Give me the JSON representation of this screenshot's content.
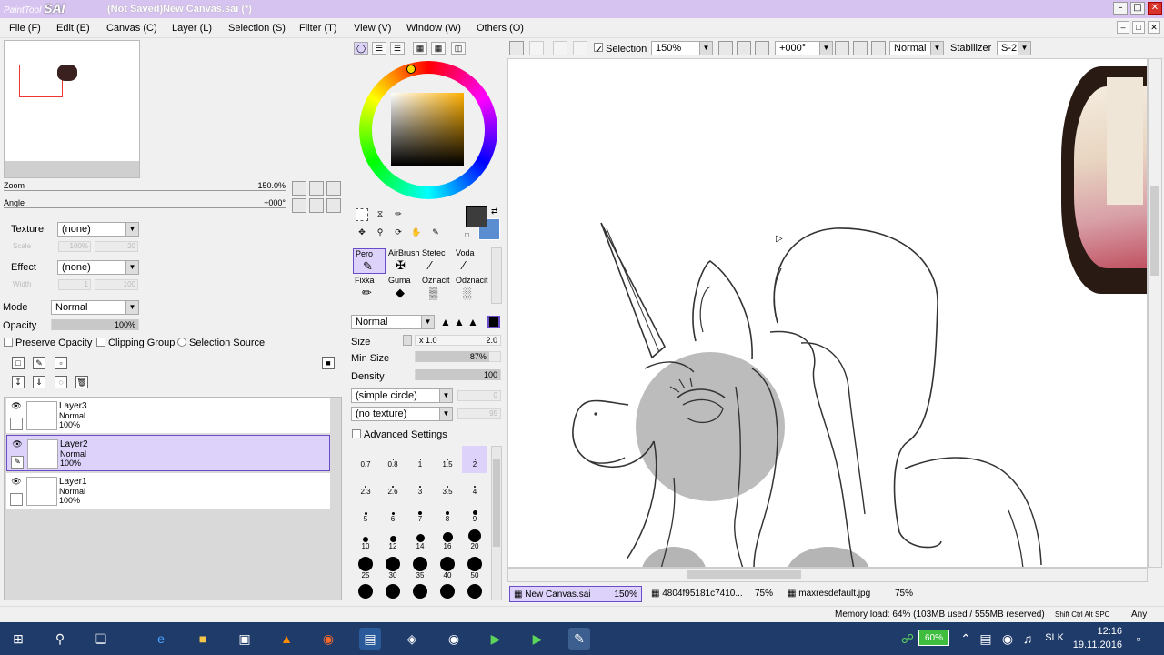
{
  "app": {
    "logo_small": "PaintTool",
    "logo_big": "SAI",
    "title": "(Not Saved)New Canvas.sai (*)"
  },
  "menu": {
    "file": "File (F)",
    "edit": "Edit (E)",
    "canvas": "Canvas (C)",
    "layer": "Layer (L)",
    "selection": "Selection (S)",
    "filter": "Filter (T)",
    "view": "View (V)",
    "window": "Window (W)",
    "others": "Others (O)"
  },
  "navigator": {
    "zoom_label": "Zoom",
    "zoom_value": "150.0%",
    "angle_label": "Angle",
    "angle_value": "+000°"
  },
  "layer_props": {
    "texture_label": "Texture",
    "texture_value": "(none)",
    "scale_label": "Scale",
    "scale_value": "100%",
    "scale_right": "20",
    "effect_label": "Effect",
    "effect_value": "(none)",
    "width_label": "Width",
    "width_value": "1",
    "width_right": "100",
    "mode_label": "Mode",
    "mode_value": "Normal",
    "opacity_label": "Opacity",
    "opacity_value": "100%",
    "preserve_opacity": "Preserve Opacity",
    "clipping_group": "Clipping Group",
    "selection_source": "Selection Source"
  },
  "layers": [
    {
      "name": "Layer3",
      "mode": "Normal",
      "opacity": "100%",
      "selected": false
    },
    {
      "name": "Layer2",
      "mode": "Normal",
      "opacity": "100%",
      "selected": true
    },
    {
      "name": "Layer1",
      "mode": "Normal",
      "opacity": "100%",
      "selected": false
    }
  ],
  "colors": {
    "primary": "#3c3c3c",
    "secondary": "#5a8ed0",
    "accent_select": "#dcd2fa",
    "accent_border": "#6a4bc9",
    "titlebar": "#d7c3f0",
    "taskbar": "#1f3b6a"
  },
  "brushes": [
    {
      "label": "Pero",
      "icon": "pen-icon",
      "selected": true
    },
    {
      "label": "AirBrush",
      "icon": "airbrush-icon",
      "selected": false
    },
    {
      "label": "Stetec",
      "icon": "brush-icon",
      "selected": false
    },
    {
      "label": "Voda",
      "icon": "water-brush-icon",
      "selected": false
    },
    {
      "label": "Fixka",
      "icon": "marker-icon",
      "selected": false
    },
    {
      "label": "Guma",
      "icon": "eraser-icon",
      "selected": false
    },
    {
      "label": "Oznacit",
      "icon": "select-pen-icon",
      "selected": false
    },
    {
      "label": "Odznacit",
      "icon": "deselect-icon",
      "selected": false
    }
  ],
  "brush_settings": {
    "blend_mode": "Normal",
    "size_label": "Size",
    "size_mult": "x 1.0",
    "size_value": "2.0",
    "min_size_label": "Min Size",
    "min_size_value": "87%",
    "min_size_fraction": 0.87,
    "density_label": "Density",
    "density_value": "100",
    "shape": "(simple circle)",
    "shape_right": "0",
    "texture": "(no texture)",
    "texture_right": "95",
    "advanced": "Advanced Settings"
  },
  "brush_sizes": [
    {
      "label": "0.7",
      "d": 1
    },
    {
      "label": "0.8",
      "d": 1
    },
    {
      "label": "1",
      "d": 1
    },
    {
      "label": "1.5",
      "d": 1
    },
    {
      "label": "2",
      "d": 1
    },
    {
      "label": "2.3",
      "d": 2
    },
    {
      "label": "2.6",
      "d": 2
    },
    {
      "label": "3",
      "d": 2
    },
    {
      "label": "3.5",
      "d": 2
    },
    {
      "label": "4",
      "d": 2
    },
    {
      "label": "5",
      "d": 3
    },
    {
      "label": "6",
      "d": 3
    },
    {
      "label": "7",
      "d": 4
    },
    {
      "label": "8",
      "d": 4
    },
    {
      "label": "9",
      "d": 5
    },
    {
      "label": "10",
      "d": 6
    },
    {
      "label": "12",
      "d": 7
    },
    {
      "label": "14",
      "d": 9
    },
    {
      "label": "16",
      "d": 11
    },
    {
      "label": "20",
      "d": 14
    },
    {
      "label": "25",
      "d": 16
    },
    {
      "label": "30",
      "d": 16
    },
    {
      "label": "35",
      "d": 16
    },
    {
      "label": "40",
      "d": 16
    },
    {
      "label": "50",
      "d": 16
    },
    {
      "label": "",
      "d": 16
    },
    {
      "label": "",
      "d": 16
    },
    {
      "label": "",
      "d": 16
    },
    {
      "label": "",
      "d": 16
    },
    {
      "label": "",
      "d": 16
    }
  ],
  "canvas_toolbar": {
    "selection_label": "Selection",
    "zoom": "150%",
    "angle": "+000°",
    "blend": "Normal",
    "stabilizer_label": "Stabilizer",
    "stabilizer_value": "S-2"
  },
  "doc_tabs": [
    {
      "name": "New Canvas.sai",
      "zoom": "150%",
      "active": true
    },
    {
      "name": "4804f95181c7410...",
      "zoom": "75%",
      "active": false
    },
    {
      "name": "maxresdefault.jpg",
      "zoom": "75%",
      "active": false
    }
  ],
  "status": {
    "memory": "Memory load: 64% (103MB used / 555MB reserved)",
    "keys": "Shift Ctrl Alt SPC",
    "any": "Any"
  },
  "taskbar": {
    "battery": "60%",
    "lang": "SLK",
    "time": "12:16",
    "date": "19.11.2016"
  }
}
